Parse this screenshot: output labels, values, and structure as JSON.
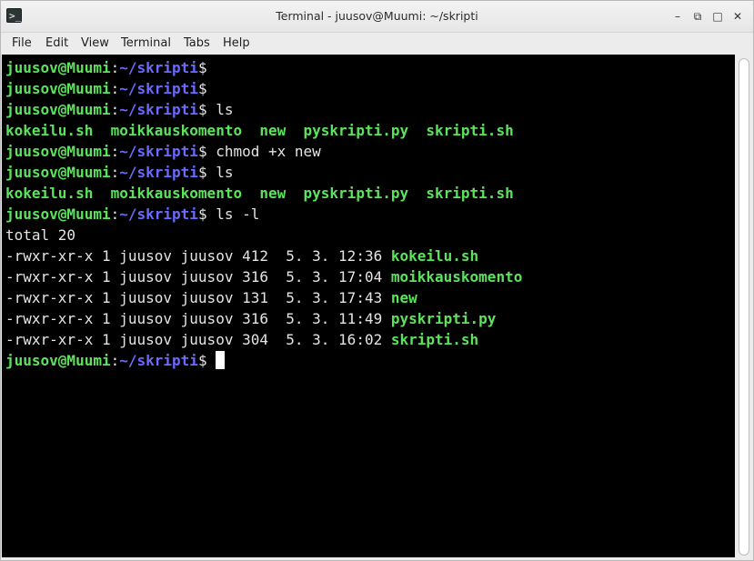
{
  "window": {
    "title": "Terminal - juusov@Muumi: ~/skripti",
    "icon_glyph": ">_",
    "minimize_glyph": "–",
    "restore_glyph": "⧉",
    "maximize_glyph": "□",
    "close_glyph": "✕"
  },
  "menu": [
    "File",
    "Edit",
    "View",
    "Terminal",
    "Tabs",
    "Help"
  ],
  "prompt": {
    "user": "juusov@Muumi",
    "sep": ":",
    "path": "~/skripti",
    "sym": "$"
  },
  "lines": [
    {
      "type": "prompt",
      "cmd": ""
    },
    {
      "type": "prompt",
      "cmd": ""
    },
    {
      "type": "prompt",
      "cmd": " ls"
    },
    {
      "type": "files",
      "text": "kokeilu.sh  moikkauskomento  new  pyskripti.py  skripti.sh"
    },
    {
      "type": "prompt",
      "cmd": " chmod +x new"
    },
    {
      "type": "prompt",
      "cmd": " ls"
    },
    {
      "type": "files",
      "text": "kokeilu.sh  moikkauskomento  new  pyskripti.py  skripti.sh"
    },
    {
      "type": "prompt",
      "cmd": " ls -l"
    },
    {
      "type": "plain",
      "text": "total 20"
    },
    {
      "type": "listing",
      "meta": "-rwxr-xr-x 1 juusov juusov 412  5. 3. 12:36 ",
      "name": "kokeilu.sh"
    },
    {
      "type": "listing",
      "meta": "-rwxr-xr-x 1 juusov juusov 316  5. 3. 17:04 ",
      "name": "moikkauskomento"
    },
    {
      "type": "listing",
      "meta": "-rwxr-xr-x 1 juusov juusov 131  5. 3. 17:43 ",
      "name": "new"
    },
    {
      "type": "listing",
      "meta": "-rwxr-xr-x 1 juusov juusov 316  5. 3. 11:49 ",
      "name": "pyskripti.py"
    },
    {
      "type": "listing",
      "meta": "-rwxr-xr-x 1 juusov juusov 304  5. 3. 16:02 ",
      "name": "skripti.sh"
    },
    {
      "type": "prompt",
      "cmd": " ",
      "cursor": true
    }
  ],
  "colors": {
    "user_green": "#5be35b",
    "path_blue": "#6a6aff",
    "text": "#e4e4e4",
    "background": "#000000"
  }
}
